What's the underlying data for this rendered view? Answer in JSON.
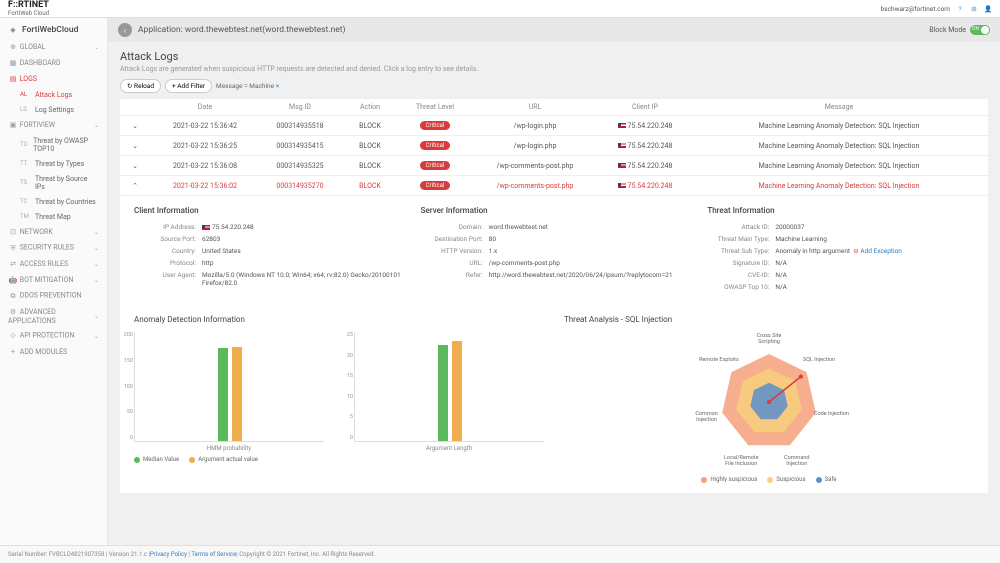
{
  "header": {
    "logo": "F::RTINET",
    "logo_sub": "FortiWeb Cloud",
    "user": "bschwarz@fortinet.com"
  },
  "sidebar": {
    "title": "FortiWebCloud",
    "global": "GLOBAL",
    "dashboard": "DASHBOARD",
    "logs": "LOGS",
    "logs_items": {
      "attack": {
        "abbr": "AL",
        "label": "Attack Logs"
      },
      "settings": {
        "abbr": "LS",
        "label": "Log Settings"
      }
    },
    "fortiview": "FORTIVIEW",
    "fortiview_items": {
      "owasp": {
        "abbr": "TO",
        "label": "Threat by OWASP TOP10"
      },
      "types": {
        "abbr": "TT",
        "label": "Threat by Types"
      },
      "sourceip": {
        "abbr": "TS",
        "label": "Threat by Source IPs"
      },
      "countries": {
        "abbr": "TC",
        "label": "Threat by Countries"
      },
      "map": {
        "abbr": "TM",
        "label": "Threat Map"
      }
    },
    "network": "NETWORK",
    "security": "SECURITY RULES",
    "access": "ACCESS RULES",
    "bot": "BOT MITIGATION",
    "ddos": "DDOS PREVENTION",
    "advanced": "ADVANCED APPLICATIONS",
    "api": "API PROTECTION",
    "add": "ADD MODULES"
  },
  "appbar": {
    "title": "Application: word.thewebtest.net(word.thewebtest.net)",
    "block_mode": "Block Mode",
    "on": "ON"
  },
  "page": {
    "title": "Attack Logs",
    "desc": "Attack Logs are generated when suspicious HTTP requests are detected and denied. Click a log entry to see details.",
    "reload": "↻ Reload",
    "add_filter": "+ Add Filter",
    "filter_tag": "Message = Machine",
    "remove": "×"
  },
  "table": {
    "headers": {
      "date": "Date",
      "msgid": "Msg ID",
      "action": "Action",
      "threat": "Threat Level",
      "url": "URL",
      "ip": "Client IP",
      "msg": "Message"
    },
    "rows": [
      {
        "date": "2021-03-22 15:36:42",
        "msgid": "000314935518",
        "action": "BLOCK",
        "threat": "Critical",
        "url": "/wp-login.php",
        "ip": "75.54.220.248",
        "msg": "Machine Learning Anomaly Detection: SQL Injection",
        "expanded": false
      },
      {
        "date": "2021-03-22 15:36:25",
        "msgid": "000314935415",
        "action": "BLOCK",
        "threat": "Critical",
        "url": "/wp-login.php",
        "ip": "75.54.220.248",
        "msg": "Machine Learning Anomaly Detection: SQL Injection",
        "expanded": false
      },
      {
        "date": "2021-03-22 15:36:08",
        "msgid": "000314935325",
        "action": "BLOCK",
        "threat": "Critical",
        "url": "/wp-comments-post.php",
        "ip": "75.54.220.248",
        "msg": "Machine Learning Anomaly Detection: SQL Injection",
        "expanded": false
      },
      {
        "date": "2021-03-22 15:36:02",
        "msgid": "000314935270",
        "action": "BLOCK",
        "threat": "Critical",
        "url": "/wp-comments-post.php",
        "ip": "75.54.220.248",
        "msg": "Machine Learning Anomaly Detection: SQL Injection",
        "expanded": true
      }
    ]
  },
  "client_info": {
    "title": "Client Information",
    "labels": {
      "ip": "IP Address:",
      "port": "Source Port:",
      "country": "Country:",
      "protocol": "Protocol:",
      "ua": "User Agent:"
    },
    "values": {
      "ip": "75.54.220.248",
      "port": "62803",
      "country": "United States",
      "protocol": "http",
      "ua": "Mozilla/5.0 (Windows NT 10.0; Win64; x64; rv:82.0) Gecko/20100101 Firefox/82.0"
    }
  },
  "server_info": {
    "title": "Server Information",
    "labels": {
      "domain": "Domain:",
      "port": "Destination Port:",
      "http": "HTTP Version:",
      "url": "URL:",
      "refer": "Refer:"
    },
    "values": {
      "domain": "word.thewebtest.net",
      "port": "80",
      "http": "1.x",
      "url": "/wp-comments-post.php",
      "refer": "http://word.thewebtest.net/2020/06/24/ipsum/?replytocom=21"
    }
  },
  "threat_info": {
    "title": "Threat Information",
    "labels": {
      "aid": "Attack ID:",
      "main": "Threat Main Type:",
      "sub": "Threat Sub Type:",
      "sig": "Signature ID:",
      "cve": "CVE-ID:",
      "owasp": "OWASP Top 10:"
    },
    "values": {
      "aid": "20000037",
      "main": "Machine Learning",
      "sub": "Anomaly in http argument",
      "sig": "N/A",
      "cve": "N/A",
      "owasp": "N/A"
    },
    "add_exc": "Add Exception"
  },
  "anomaly": {
    "title": "Anomaly Detection Information",
    "legend": {
      "median": "Median Value",
      "actual": "Argument actual value"
    }
  },
  "threat_analysis": {
    "title": "Threat Analysis - SQL Injection",
    "legend": {
      "high": "Highly suspicious",
      "susp": "Suspicious",
      "safe": "Safe"
    },
    "labels": [
      "Cross Site Scripting",
      "SQL Injection",
      "Code Injection",
      "Command Injection",
      "Local/Remote File Inclusion",
      "Common Injection",
      "Remote Exploits"
    ]
  },
  "chart_data": [
    {
      "type": "bar",
      "title": "HMM probability",
      "categories": [
        "HMM probability"
      ],
      "series": [
        {
          "name": "Median Value",
          "values": [
            170
          ]
        },
        {
          "name": "Argument actual value",
          "values": [
            172
          ]
        }
      ],
      "ylim": [
        0,
        200
      ],
      "yticks": [
        0,
        50,
        100,
        150,
        200
      ]
    },
    {
      "type": "bar",
      "title": "Argument Length",
      "categories": [
        "Argument Length"
      ],
      "series": [
        {
          "name": "Median Value",
          "values": [
            22
          ]
        },
        {
          "name": "Argument actual value",
          "values": [
            23
          ]
        }
      ],
      "ylim": [
        0,
        25
      ],
      "yticks": [
        0,
        5,
        10,
        15,
        20,
        25
      ]
    },
    {
      "type": "radar",
      "title": "Threat Analysis - SQL Injection",
      "categories": [
        "Cross Site Scripting",
        "SQL Injection",
        "Code Injection",
        "Command Injection",
        "Local/Remote File Inclusion",
        "Common Injection",
        "Remote Exploits"
      ],
      "rings": [
        {
          "name": "Highly suspicious",
          "color": "#f4a07a",
          "radius": 1.0
        },
        {
          "name": "Suspicious",
          "color": "#f7cf7e",
          "radius": 0.7
        },
        {
          "name": "Safe",
          "color": "#5b8fcc",
          "radius": 0.4
        }
      ],
      "indicator": {
        "category": "SQL Injection",
        "value": 0.85,
        "color": "#d83b3b"
      }
    }
  ],
  "footer": {
    "serial": "Serial Number: FVBCLD4821907358 | Version 21.1.c | ",
    "privacy": "Privacy Policy",
    "terms": "Terms of Service",
    "copyright": " | Copyright © 2021 Fortinet, Inc. All Rights Reserved."
  }
}
